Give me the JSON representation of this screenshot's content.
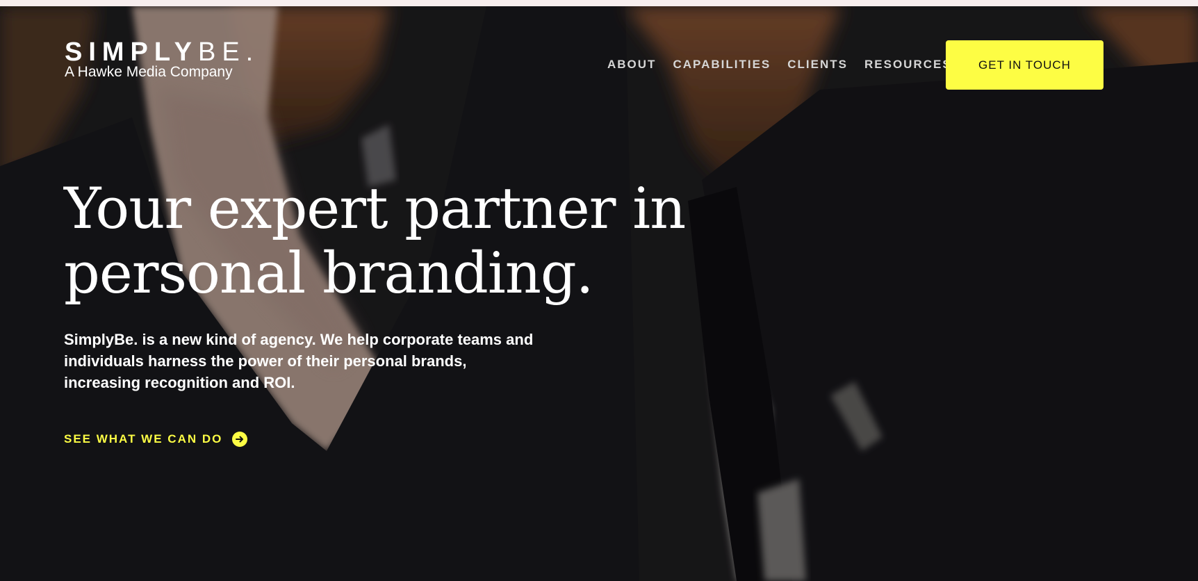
{
  "logo": {
    "word_strong": "SIMPLY",
    "word_light": "BE.",
    "tagline": "A Hawke Media Company"
  },
  "nav": {
    "items": [
      {
        "label": "ABOUT"
      },
      {
        "label": "CAPABILITIES"
      },
      {
        "label": "CLIENTS"
      },
      {
        "label": "RESOURCES"
      }
    ],
    "cta_label": "GET IN TOUCH"
  },
  "hero": {
    "headline_line1": "Your expert partner in",
    "headline_line2": "personal branding.",
    "subtext_line1": "SimplyBe. is a new kind of agency. We help corporate teams and",
    "subtext_line2": "individuals harness the power of their personal brands,",
    "subtext_line3": "increasing recognition and ROI.",
    "link_label": "SEE WHAT WE CAN DO",
    "link_icon": "arrow-right-circle-icon"
  },
  "colors": {
    "accent": "#fdfd44",
    "hero_background": "#1c1b1d",
    "text": "#ffffff"
  }
}
